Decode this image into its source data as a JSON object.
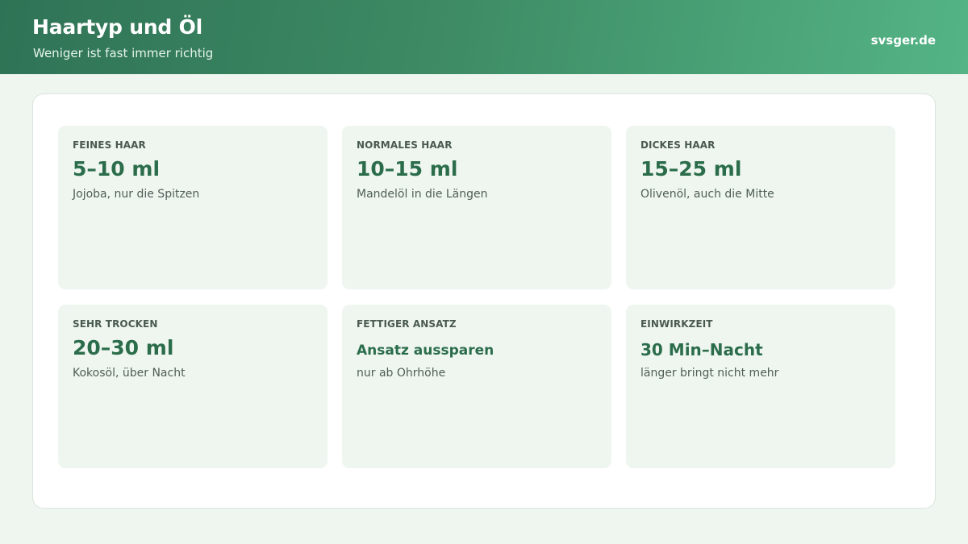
{
  "header": {
    "title": "Haartyp und Öl",
    "subtitle": "Weniger ist fast immer richtig",
    "brand": "svsger.de"
  },
  "cards": [
    {
      "label": "FEINES HAAR",
      "value": "5–10 ml",
      "desc": "Jojoba, nur die Spitzen"
    },
    {
      "label": "NORMALES HAAR",
      "value": "10–15 ml",
      "desc": "Mandelöl in die Längen"
    },
    {
      "label": "DICKES HAAR",
      "value": "15–25 ml",
      "desc": "Olivenöl, auch die Mitte"
    },
    {
      "label": "SEHR TROCKEN",
      "value": "20–30 ml",
      "desc": "Kokosöl, über Nacht"
    },
    {
      "label": "FETTIGER ANSATZ",
      "value": "Ansatz aussparen",
      "desc": "nur ab Ohrhöhe"
    },
    {
      "label": "EINWIRKZEIT",
      "value": "30 Min–Nacht",
      "desc": "länger bringt nicht mehr"
    }
  ],
  "colors": {
    "header_start": "#2f7356",
    "header_end": "#54b485",
    "accent": "#2b6d4b",
    "card_bg": "#eff6f0",
    "page_bg": "#eef6ef"
  }
}
